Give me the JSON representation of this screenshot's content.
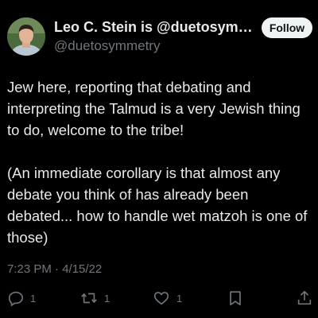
{
  "author": {
    "display_name": "Leo C. Stein is @duetosymmetry",
    "handle": "@duetosymmetry"
  },
  "follow_button": {
    "label": "Follow"
  },
  "tweet": {
    "paragraphs": [
      "Jew here, reporting that debating and interpreting the Talmud is a very Jewish thing to do, welcome to the tribe!",
      "(An immediate corollary is that almost any debate you think of has already been debated... how to handle wet matzoh is one of those)"
    ],
    "timestamp": "7:23 PM · 4/15/22"
  },
  "actions": {
    "reply": {
      "icon": "reply-icon",
      "count": "1"
    },
    "retweet": {
      "icon": "retweet-icon",
      "count": "1"
    },
    "like": {
      "icon": "heart-icon",
      "count": "1"
    },
    "bookmark": {
      "icon": "bookmark-icon"
    },
    "share": {
      "icon": "share-icon"
    }
  },
  "colors": {
    "background": "#000000",
    "text": "#e7e9ea",
    "secondary_text": "#71767b",
    "follow_bg": "#eff3f4"
  }
}
